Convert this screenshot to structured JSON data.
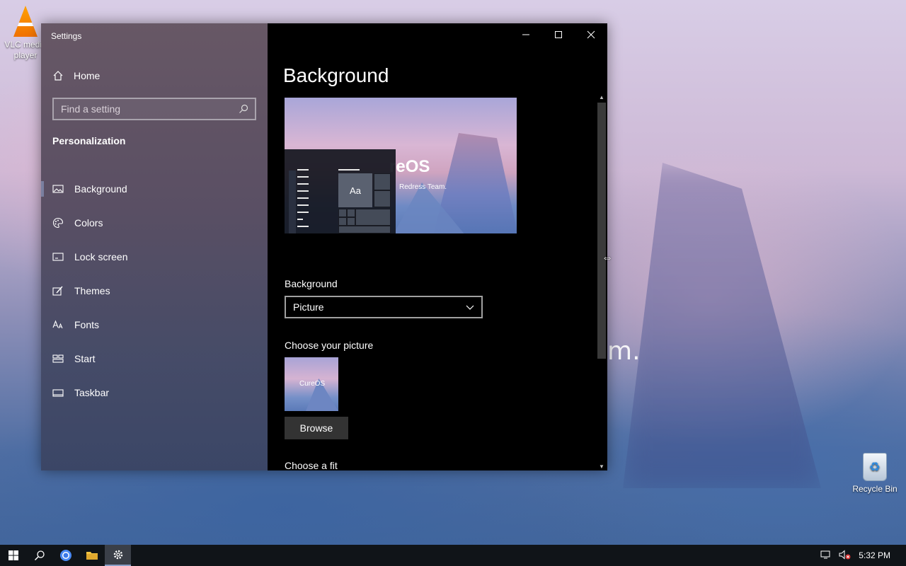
{
  "desktop": {
    "icons": [
      {
        "label": "VLC media player"
      },
      {
        "label": "Recycle Bin"
      }
    ],
    "wallpaper_text": "m."
  },
  "window": {
    "title": "Settings",
    "controls": {
      "minimize_icon": "minimize-icon",
      "maximize_icon": "maximize-icon",
      "close_icon": "close-icon"
    }
  },
  "sidebar": {
    "home_label": "Home",
    "search_placeholder": "Find a setting",
    "section_title": "Personalization",
    "items": [
      {
        "label": "Background",
        "icon": "picture-icon",
        "active": true
      },
      {
        "label": "Colors",
        "icon": "palette-icon",
        "active": false
      },
      {
        "label": "Lock screen",
        "icon": "lock-screen-icon",
        "active": false
      },
      {
        "label": "Themes",
        "icon": "themes-icon",
        "active": false
      },
      {
        "label": "Fonts",
        "icon": "fonts-icon",
        "active": false
      },
      {
        "label": "Start",
        "icon": "start-icon",
        "active": false
      },
      {
        "label": "Taskbar",
        "icon": "taskbar-icon",
        "active": false
      }
    ]
  },
  "main": {
    "page_title": "Background",
    "preview": {
      "brand": "reOS",
      "subtitle": "Redress Team.",
      "tile_label": "Aa"
    },
    "background_label": "Background",
    "background_value": "Picture",
    "choose_picture_label": "Choose your picture",
    "thumbnail_brand": "CureOS",
    "browse_label": "Browse",
    "choose_fit_label": "Choose a fit"
  },
  "taskbar": {
    "clock": "5:32 PM"
  },
  "colors": {
    "window_bg": "#000000",
    "taskbar_bg": "#101418",
    "accent": "#8aa0c8"
  }
}
